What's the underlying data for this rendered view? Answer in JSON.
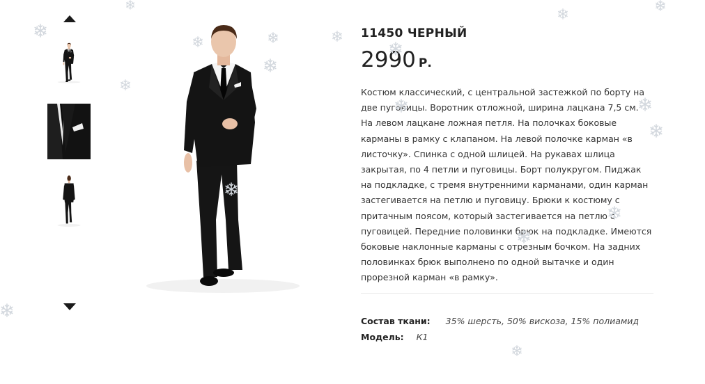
{
  "gallery": {
    "prev_icon": "triangle-up-icon",
    "next_icon": "triangle-down-icon",
    "thumbnails": [
      {
        "view": "front-full"
      },
      {
        "view": "lapel-closeup"
      },
      {
        "view": "back-full"
      }
    ]
  },
  "product": {
    "title": "11450 ЧЕРНЫЙ",
    "price": "2990",
    "currency": "Р.",
    "description": "Костюм классический, с центральной застежкой по борту на две пуговицы. Воротник отложной, ширина лацкана 7,5 см. На левом лацкане ложная петля. На полочках боковые карманы в рамку с клапаном. На левой полочке карман «в листочку». Спинка с одной шлицей. На рукавах шлица закрытая, по 4 петли и пуговицы. Борт полукругом. Пиджак на подкладке, с тремя внутренними карманами, один карман застегивается на петлю и пуговицу. Брюки к костюму с притачным поясом, который застегивается на петлю с пуговицей. Передние половинки брюк на подкладке. Имеются боковые наклонные карманы с отрезным бочком. На задних половинках брюк выполнено по одной вытачке и один прорезной карман «в рамку»."
  },
  "specs": {
    "fabric_label": "Состав ткани:",
    "fabric_value": "35% шерсть, 50% вискоза, 15% полиамид",
    "model_label": "Модель:",
    "model_value": "К1"
  },
  "colors": {
    "suit": "#151515",
    "snowflake": "#d9dde2",
    "text": "#222222"
  }
}
